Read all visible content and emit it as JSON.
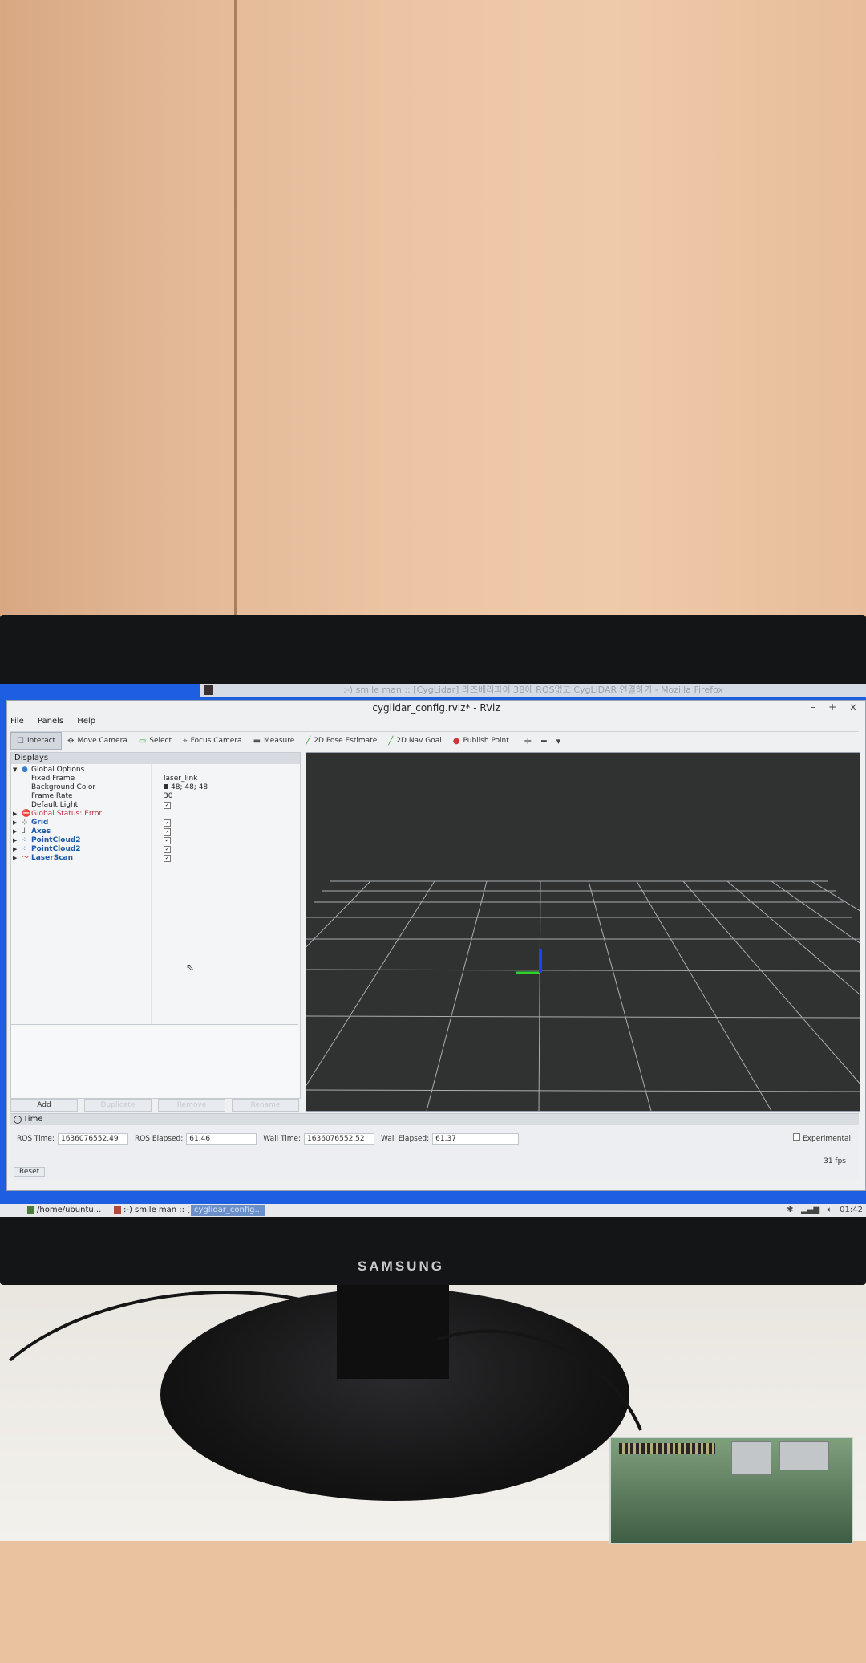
{
  "firefox": {
    "title": ":-) smile man :: [CygLidar] 라즈베리파이 3B에 ROS없고 CygLiDAR 연결하기 - Mozilla Firefox"
  },
  "rviz": {
    "title": "cyglidar_config.rviz* - RViz",
    "window_controls": "– + ×",
    "menu": [
      "File",
      "Panels",
      "Help"
    ],
    "toolbar": [
      {
        "label": "Interact",
        "icon": "interact-icon",
        "active": true
      },
      {
        "label": "Move Camera",
        "icon": "move-camera-icon"
      },
      {
        "label": "Select",
        "icon": "select-icon"
      },
      {
        "label": "Focus Camera",
        "icon": "focus-camera-icon"
      },
      {
        "label": "Measure",
        "icon": "measure-icon"
      },
      {
        "label": "2D Pose Estimate",
        "icon": "pose-arrow-icon"
      },
      {
        "label": "2D Nav Goal",
        "icon": "nav-arrow-icon"
      },
      {
        "label": "Publish Point",
        "icon": "pin-icon"
      }
    ],
    "displays": {
      "header": "Displays",
      "global_options": "Global Options",
      "properties": [
        {
          "name": "Fixed Frame",
          "value": "laser_link"
        },
        {
          "name": "Background Color",
          "value": "48; 48; 48"
        },
        {
          "name": "Frame Rate",
          "value": "30"
        },
        {
          "name": "Default Light",
          "value": "✓"
        }
      ],
      "global_status": "Global Status: Error",
      "items": [
        {
          "name": "Grid",
          "checked": "✓"
        },
        {
          "name": "Axes",
          "checked": "✓"
        },
        {
          "name": "PointCloud2",
          "checked": "✓"
        },
        {
          "name": "PointCloud2",
          "checked": "✓"
        },
        {
          "name": "LaserScan",
          "checked": "✓"
        }
      ],
      "buttons": [
        "Add",
        "Duplicate",
        "Remove",
        "Rename"
      ]
    },
    "time": {
      "header": "Time",
      "ros_time_label": "ROS Time:",
      "ros_time": "1636076552.49",
      "ros_elapsed_label": "ROS Elapsed:",
      "ros_elapsed": "61.46",
      "wall_time_label": "Wall Time:",
      "wall_time": "1636076552.52",
      "wall_elapsed_label": "Wall Elapsed:",
      "wall_elapsed": "61.37",
      "experimental": "Experimental",
      "fps": "31 fps",
      "reset": "Reset"
    }
  },
  "taskbar": {
    "items": [
      "/home/ubuntu...",
      ":-) smile man :: [...",
      "cyglidar_config..."
    ],
    "clock": "01:42"
  },
  "monitor": {
    "brand": "SAMSUNG"
  },
  "colors": {
    "screen_bg": "#1d5fe0",
    "view_bg": "#303232",
    "axis_x": "#2fd02f",
    "axis_z": "#1f3dff",
    "error": "#c03040",
    "display_name": "#1e5aa8"
  }
}
